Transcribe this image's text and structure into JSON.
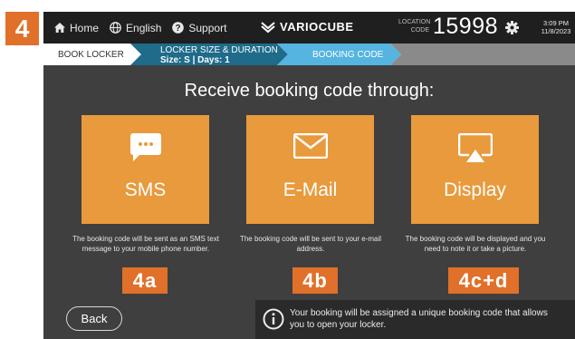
{
  "step_badge": "4",
  "topbar": {
    "home_label": "Home",
    "language_label": "English",
    "support_label": "Support",
    "logo_text": "VARIOCUBE",
    "location_label_line1": "LOCATION",
    "location_label_line2": "CODE",
    "location_code": "15998",
    "time": "3:09 PM",
    "date": "11/8/2023"
  },
  "breadcrumb": {
    "step1": "BOOK LOCKER",
    "step2_title": "LOCKER SIZE & DURATION",
    "step2_detail": "Size: S | Days: 1",
    "step3": "BOOKING CODE"
  },
  "main": {
    "heading": "Receive booking code through:",
    "options": [
      {
        "label": "SMS",
        "icon": "sms-icon",
        "description": "The booking code will be sent as an SMS text message to your mobile phone number.",
        "tag": "4a"
      },
      {
        "label": "E-Mail",
        "icon": "email-icon",
        "description": "The booking code will be sent to your e-mail address.",
        "tag": "4b"
      },
      {
        "label": "Display",
        "icon": "display-icon",
        "description": "The booking code will be displayed and you need to note it or take a picture.",
        "tag": "4c+d"
      }
    ],
    "back_label": "Back",
    "info_text": "Your booking will be assigned a unique booking code that allows you to open your locker."
  },
  "colors": {
    "accent_orange": "#e0702a",
    "tile_orange": "#e89a3c",
    "crumb_dark": "#1e6b8a",
    "crumb_active": "#56b4e0",
    "screen_bg": "#3f3f3f"
  }
}
